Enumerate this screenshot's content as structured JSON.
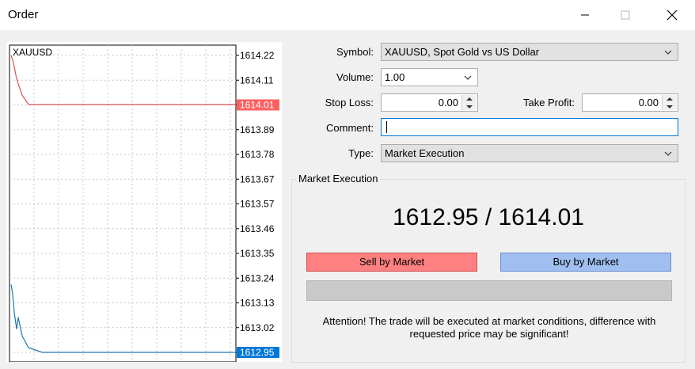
{
  "window": {
    "title": "Order",
    "minimize_icon": "minimize-icon",
    "maximize_icon": "maximize-icon",
    "close_icon": "close-icon"
  },
  "chart": {
    "symbol": "XAUUSD",
    "price_labels": [
      "1614.22",
      "1614.11",
      "1614.01",
      "1613.89",
      "1613.78",
      "1613.67",
      "1613.57",
      "1613.46",
      "1613.35",
      "1613.24",
      "1613.13",
      "1613.02",
      "1612.95"
    ],
    "ask_marker": "1614.01",
    "bid_marker": "1612.95",
    "ask_color": "#ff4040",
    "bid_color": "#0078d7"
  },
  "chart_data": {
    "type": "line",
    "ylim": [
      1612.95,
      1614.22
    ],
    "series": [
      {
        "color": "#e05050",
        "values": [
          1614.22,
          1614.2,
          1614.17,
          1614.12,
          1614.1,
          1614.05,
          1614.01,
          1614.01,
          1614.01,
          1614.01,
          1614.01,
          1614.01,
          1614.01,
          1614.01,
          1614.01,
          1614.01,
          1614.01,
          1614.01,
          1614.01,
          1614.01,
          1614.01,
          1614.01
        ]
      },
      {
        "color": "#1f78b4",
        "values": [
          1613.24,
          1613.2,
          1613.12,
          1613.05,
          1613.1,
          1613.02,
          1612.97,
          1612.95,
          1612.95,
          1612.95,
          1612.95,
          1612.95,
          1612.95,
          1612.95,
          1612.95,
          1612.95,
          1612.95,
          1612.95,
          1612.95,
          1612.95,
          1612.95,
          1612.95
        ]
      }
    ]
  },
  "form": {
    "symbol_label": "Symbol:",
    "symbol_value": "XAUUSD, Spot Gold vs US Dollar",
    "volume_label": "Volume:",
    "volume_value": "1.00",
    "stoploss_label": "Stop Loss:",
    "stoploss_value": "0.00",
    "takeprofit_label": "Take Profit:",
    "takeprofit_value": "0.00",
    "comment_label": "Comment:",
    "comment_value": "",
    "type_label": "Type:",
    "type_value": "Market Execution"
  },
  "execution": {
    "group_title": "Market Execution",
    "prices": "1612.95 / 1614.01",
    "sell_label": "Sell by Market",
    "buy_label": "Buy by Market",
    "attention_line1": "Attention! The trade will be executed at market conditions, difference with",
    "attention_line2": "requested price may be significant!"
  }
}
